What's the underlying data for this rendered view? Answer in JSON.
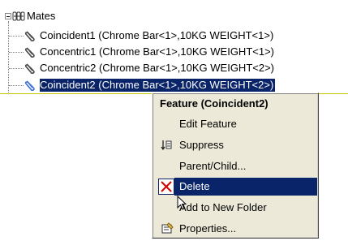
{
  "tree": {
    "root": {
      "label": "Mates",
      "icon": "mates-folder-icon"
    },
    "items": [
      {
        "label": "Coincident1 (Chrome Bar<1>,10KG WEIGHT<1>)",
        "icon": "mate-paperclip-icon",
        "selected": false
      },
      {
        "label": "Concentric1 (Chrome Bar<1>,10KG WEIGHT<1>)",
        "icon": "mate-paperclip-icon",
        "selected": false
      },
      {
        "label": "Concentric2 (Chrome Bar<1>,10KG WEIGHT<2>)",
        "icon": "mate-paperclip-icon",
        "selected": false
      },
      {
        "label": "Coincident2 (Chrome Bar<1>,10KG WEIGHT<2>)",
        "icon": "mate-paperclip-icon",
        "selected": true
      }
    ]
  },
  "context_menu": {
    "header": "Feature (Coincident2)",
    "items": [
      {
        "label": "Edit Feature",
        "icon": ""
      },
      {
        "label": "Suppress",
        "icon": "suppress-icon"
      },
      {
        "label": "Parent/Child...",
        "icon": ""
      },
      {
        "label": "Delete",
        "icon": "delete-x-icon",
        "highlighted": true
      },
      {
        "label": "Add to New Folder",
        "icon": ""
      },
      {
        "label": "Properties...",
        "icon": "properties-icon"
      }
    ]
  },
  "colors": {
    "selection": "#0a246a",
    "menu_bg": "#ece9d8",
    "delete_x": "#d40000",
    "divider": "#c6c600"
  }
}
